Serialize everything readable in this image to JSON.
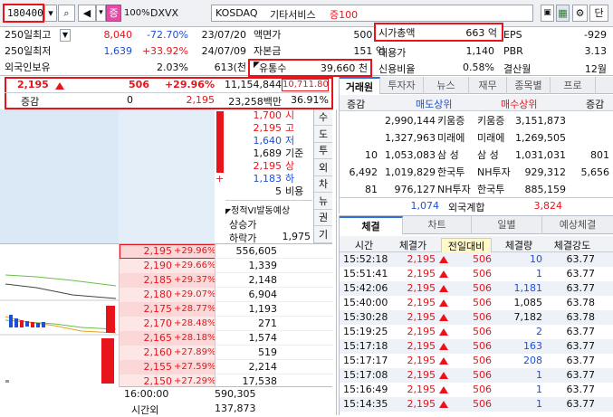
{
  "toolbar": {
    "code": "180400",
    "volume_label": "100%",
    "stock_badge": "증",
    "stock_name": "DXVX",
    "market": "KOSDAQ",
    "sector": "기타서비스",
    "margin": "증100",
    "button_last": "단"
  },
  "info": {
    "r1": {
      "label": "250일최고",
      "price": "8,040",
      "pct": "-72.70%",
      "date": "23/07/20",
      "l2": "액면가",
      "v2": "500 원",
      "l3": "시가총액",
      "v3": "663 억",
      "l4": "EPS",
      "v4": "-929"
    },
    "r2": {
      "label": "250일최저",
      "price": "1,639",
      "pct": "+33.92%",
      "date": "24/07/09",
      "l2": "자본금",
      "v2": "151 억",
      "l3": "대용가",
      "v3": "1,140",
      "l4": "PBR",
      "v4": "3.13"
    },
    "r3": {
      "label": "외국인보유",
      "pct": "2.03%",
      "date": "613(천",
      "l2": "유통수",
      "v2": "39,660 천",
      "l3": "신용비율",
      "v3": "0.58%",
      "l4": "결산월",
      "v4": "12월"
    }
  },
  "quote": {
    "price": "2,195",
    "change": "506",
    "pct": "+29.96%",
    "volume": "11,154,844",
    "volume2": "10,711.80",
    "label_inc": "증감",
    "zero": "0",
    "price2": "2,195",
    "amount": "23,258백만",
    "ratio": "36.91%"
  },
  "summary": [
    {
      "v": "1,700",
      "k": "시",
      "c": "red"
    },
    {
      "v": "2,195",
      "k": "고",
      "c": "red"
    },
    {
      "v": "1,640",
      "k": "저",
      "c": "blue"
    },
    {
      "v": "1,689",
      "k": "기준",
      "c": "black"
    },
    {
      "v": "2,195",
      "k": "상",
      "c": "red"
    },
    {
      "v": "1,183",
      "k": "하",
      "c": "blue"
    },
    {
      "v": "5",
      "k": "비용",
      "c": "black"
    }
  ],
  "vi": {
    "title": "정적VI발동예상",
    "up": "상승가",
    "down": "하락가",
    "down_val": "1,975"
  },
  "side_tabs": [
    "수",
    "도",
    "투",
    "외",
    "차",
    "뉴",
    "권",
    "기"
  ],
  "asks": [],
  "bids": [
    {
      "p": "2,195",
      "r": "+29.96%",
      "q": "556,605"
    },
    {
      "p": "2,190",
      "r": "+29.66%",
      "q": "1,339"
    },
    {
      "p": "2,185",
      "r": "+29.37%",
      "q": "2,148"
    },
    {
      "p": "2,180",
      "r": "+29.07%",
      "q": "6,904"
    },
    {
      "p": "2,175",
      "r": "+28.77%",
      "q": "1,193"
    },
    {
      "p": "2,170",
      "r": "+28.48%",
      "q": "271"
    },
    {
      "p": "2,165",
      "r": "+28.18%",
      "q": "1,574"
    },
    {
      "p": "2,160",
      "r": "+27.89%",
      "q": "519"
    },
    {
      "p": "2,155",
      "r": "+27.59%",
      "q": "2,214"
    },
    {
      "p": "2,150",
      "r": "+27.29%",
      "q": "17,538"
    }
  ],
  "foot": {
    "time": "16:00:00",
    "q1": "590,305",
    "after": "시간외",
    "q2": "137,873"
  },
  "broker": {
    "tabs": [
      "거래원",
      "투자자",
      "뉴스",
      "재무",
      "종목별",
      "프로"
    ],
    "h_inc_l": "증감",
    "h_sell": "매도상위",
    "h_buy": "매수상위",
    "h_inc_r": "증감",
    "rows": [
      {
        "a": "",
        "b": "2,990,144",
        "c": "키움증",
        "d": "키움증",
        "e": "3,151,873",
        "f": ""
      },
      {
        "a": "",
        "b": "1,327,963",
        "c": "미래에",
        "d": "미래에",
        "e": "1,269,505",
        "f": ""
      },
      {
        "a": "10",
        "b": "1,053,083",
        "c": "삼 성",
        "d": "삼 성",
        "e": "1,031,031",
        "f": "801"
      },
      {
        "a": "6,492",
        "b": "1,019,829",
        "c": "한국투",
        "d": "NH투자",
        "e": "929,312",
        "f": "5,656"
      },
      {
        "a": "81",
        "b": "976,127",
        "c": "NH투자",
        "d": "한국투",
        "e": "885,159",
        "f": ""
      }
    ],
    "foreign": {
      "sell": "1,074",
      "label": "외국계합",
      "buy": "3,824"
    }
  },
  "trades": {
    "tabs": [
      "체결",
      "차트",
      "일별",
      "예상체결"
    ],
    "headers": [
      "시간",
      "체결가",
      "전일대비",
      "체결량",
      "체결강도"
    ],
    "rows": [
      {
        "t": "15:52:18",
        "p": "2,195",
        "d": "506",
        "q": "10",
        "s": "63.77",
        "qc": "blue"
      },
      {
        "t": "15:51:41",
        "p": "2,195",
        "d": "506",
        "q": "1",
        "s": "63.77",
        "qc": "blue"
      },
      {
        "t": "15:42:06",
        "p": "2,195",
        "d": "506",
        "q": "1,181",
        "s": "63.77",
        "qc": "blue"
      },
      {
        "t": "15:40:00",
        "p": "2,195",
        "d": "506",
        "q": "1,085",
        "s": "63.78",
        "qc": "black"
      },
      {
        "t": "15:30:28",
        "p": "2,195",
        "d": "506",
        "q": "7,182",
        "s": "63.78",
        "qc": "black"
      },
      {
        "t": "15:19:25",
        "p": "2,195",
        "d": "506",
        "q": "2",
        "s": "63.77",
        "qc": "blue"
      },
      {
        "t": "15:17:18",
        "p": "2,195",
        "d": "506",
        "q": "163",
        "s": "63.77",
        "qc": "blue"
      },
      {
        "t": "15:17:17",
        "p": "2,195",
        "d": "506",
        "q": "208",
        "s": "63.77",
        "qc": "blue"
      },
      {
        "t": "15:17:08",
        "p": "2,195",
        "d": "506",
        "q": "1",
        "s": "63.77",
        "qc": "blue"
      },
      {
        "t": "15:16:49",
        "p": "2,195",
        "d": "506",
        "q": "1",
        "s": "63.77",
        "qc": "blue"
      },
      {
        "t": "15:14:35",
        "p": "2,195",
        "d": "506",
        "q": "1",
        "s": "63.77",
        "qc": "blue"
      }
    ]
  }
}
